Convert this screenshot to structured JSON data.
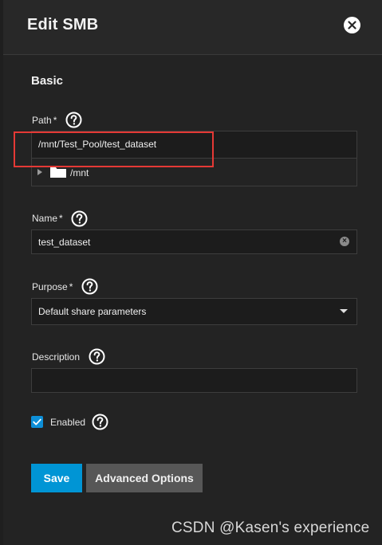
{
  "dialog": {
    "title": "Edit SMB",
    "section_title": "Basic"
  },
  "path": {
    "label": "Path",
    "required": "*",
    "value": "/mnt/Test_Pool/test_dataset",
    "tree_item": "/mnt"
  },
  "name": {
    "label": "Name",
    "required": "*",
    "value": "test_dataset"
  },
  "purpose": {
    "label": "Purpose",
    "required": "*",
    "value": "Default share parameters"
  },
  "description": {
    "label": "Description",
    "value": ""
  },
  "enabled": {
    "label": "Enabled",
    "checked": true
  },
  "buttons": {
    "save": "Save",
    "advanced": "Advanced Options"
  },
  "watermark": "CSDN @Kasen's experience",
  "colors": {
    "accent": "#0095d5",
    "highlight": "#e53935",
    "background": "#232323"
  }
}
